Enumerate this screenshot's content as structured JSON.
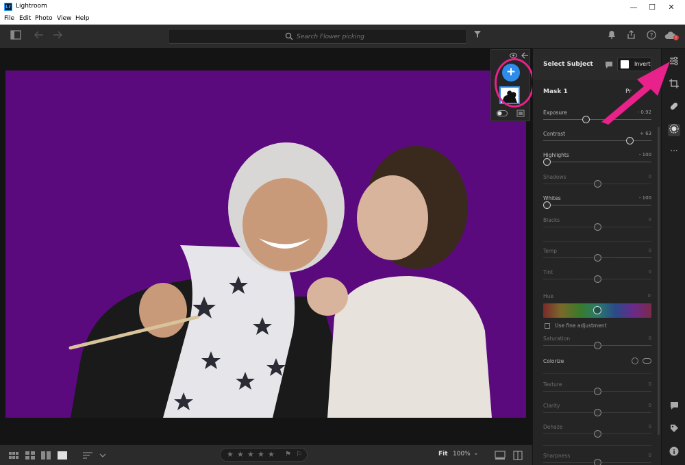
{
  "window": {
    "title": "Lightroom",
    "logo_text": "Lr",
    "minimize": "—",
    "maximize": "☐",
    "close": "✕"
  },
  "menu": [
    {
      "label": "File"
    },
    {
      "label": "Edit"
    },
    {
      "label": "Photo"
    },
    {
      "label": "View"
    },
    {
      "label": "Help"
    }
  ],
  "toolbar": {
    "search_placeholder": "Search Flower picking",
    "icons": [
      "panel-toggle-icon",
      "back-arrow-icon",
      "forward-arrow-icon",
      "filter-icon",
      "notifications-icon",
      "share-icon",
      "help-icon",
      "cloud-sync-icon"
    ]
  },
  "mask_panel": {
    "select_subject_label": "Select Subject",
    "invert_label": "Invert",
    "mask_name": "Mask 1",
    "mask_aux_label": "Pr",
    "add_mask_symbol": "+",
    "sliders": [
      {
        "key": "exposure",
        "label": "Exposure",
        "value": "- 0.92",
        "level": 0.39,
        "dim": false
      },
      {
        "key": "contrast",
        "label": "Contrast",
        "value": "+ 63",
        "level": 0.8,
        "dim": false
      },
      {
        "key": "highlights",
        "label": "Highlights",
        "value": "- 100",
        "level": 0.0,
        "dim": false
      },
      {
        "key": "shadows",
        "label": "Shadows",
        "value": "0",
        "level": 0.5,
        "dim": true
      },
      {
        "key": "whites",
        "label": "Whites",
        "value": "- 100",
        "level": 0.0,
        "dim": false
      },
      {
        "key": "blacks",
        "label": "Blacks",
        "value": "0",
        "level": 0.5,
        "dim": true
      },
      {
        "key": "temp",
        "label": "Temp",
        "value": "0",
        "level": 0.5,
        "dim": true
      },
      {
        "key": "tint",
        "label": "Tint",
        "value": "0",
        "level": 0.5,
        "dim": true
      },
      {
        "key": "saturation",
        "label": "Saturation",
        "value": "0",
        "level": 0.5,
        "dim": true
      },
      {
        "key": "texture",
        "label": "Texture",
        "value": "0",
        "level": 0.5,
        "dim": true
      },
      {
        "key": "clarity",
        "label": "Clarity",
        "value": "0",
        "level": 0.5,
        "dim": true
      },
      {
        "key": "dehaze",
        "label": "Dehaze",
        "value": "0",
        "level": 0.5,
        "dim": true
      },
      {
        "key": "sharpness",
        "label": "Sharpness",
        "value": "0",
        "level": 0.5,
        "dim": true
      }
    ],
    "hue_label": "Hue",
    "hue_value": "0",
    "fine_adjust_label": "Use fine adjustment",
    "colorize_label": "Colorize"
  },
  "tool_strip": {
    "icons": [
      "edit-sliders-icon",
      "crop-icon",
      "healing-icon",
      "masking-icon",
      "more-icon",
      "comments-icon",
      "tag-icon",
      "info-icon"
    ],
    "more_label": "···",
    "info_label": "i"
  },
  "bottom_bar": {
    "rating_stars": [
      "★",
      "★",
      "★",
      "★",
      "★"
    ],
    "flags": [
      "⚑",
      "⚐"
    ],
    "fit_label": "Fit",
    "zoom_label": "100%",
    "caret": "⌄"
  },
  "colors": {
    "accent": "#2d8ceb",
    "annotation": "#e8228a",
    "mask_overlay": "#5b0a7e"
  }
}
